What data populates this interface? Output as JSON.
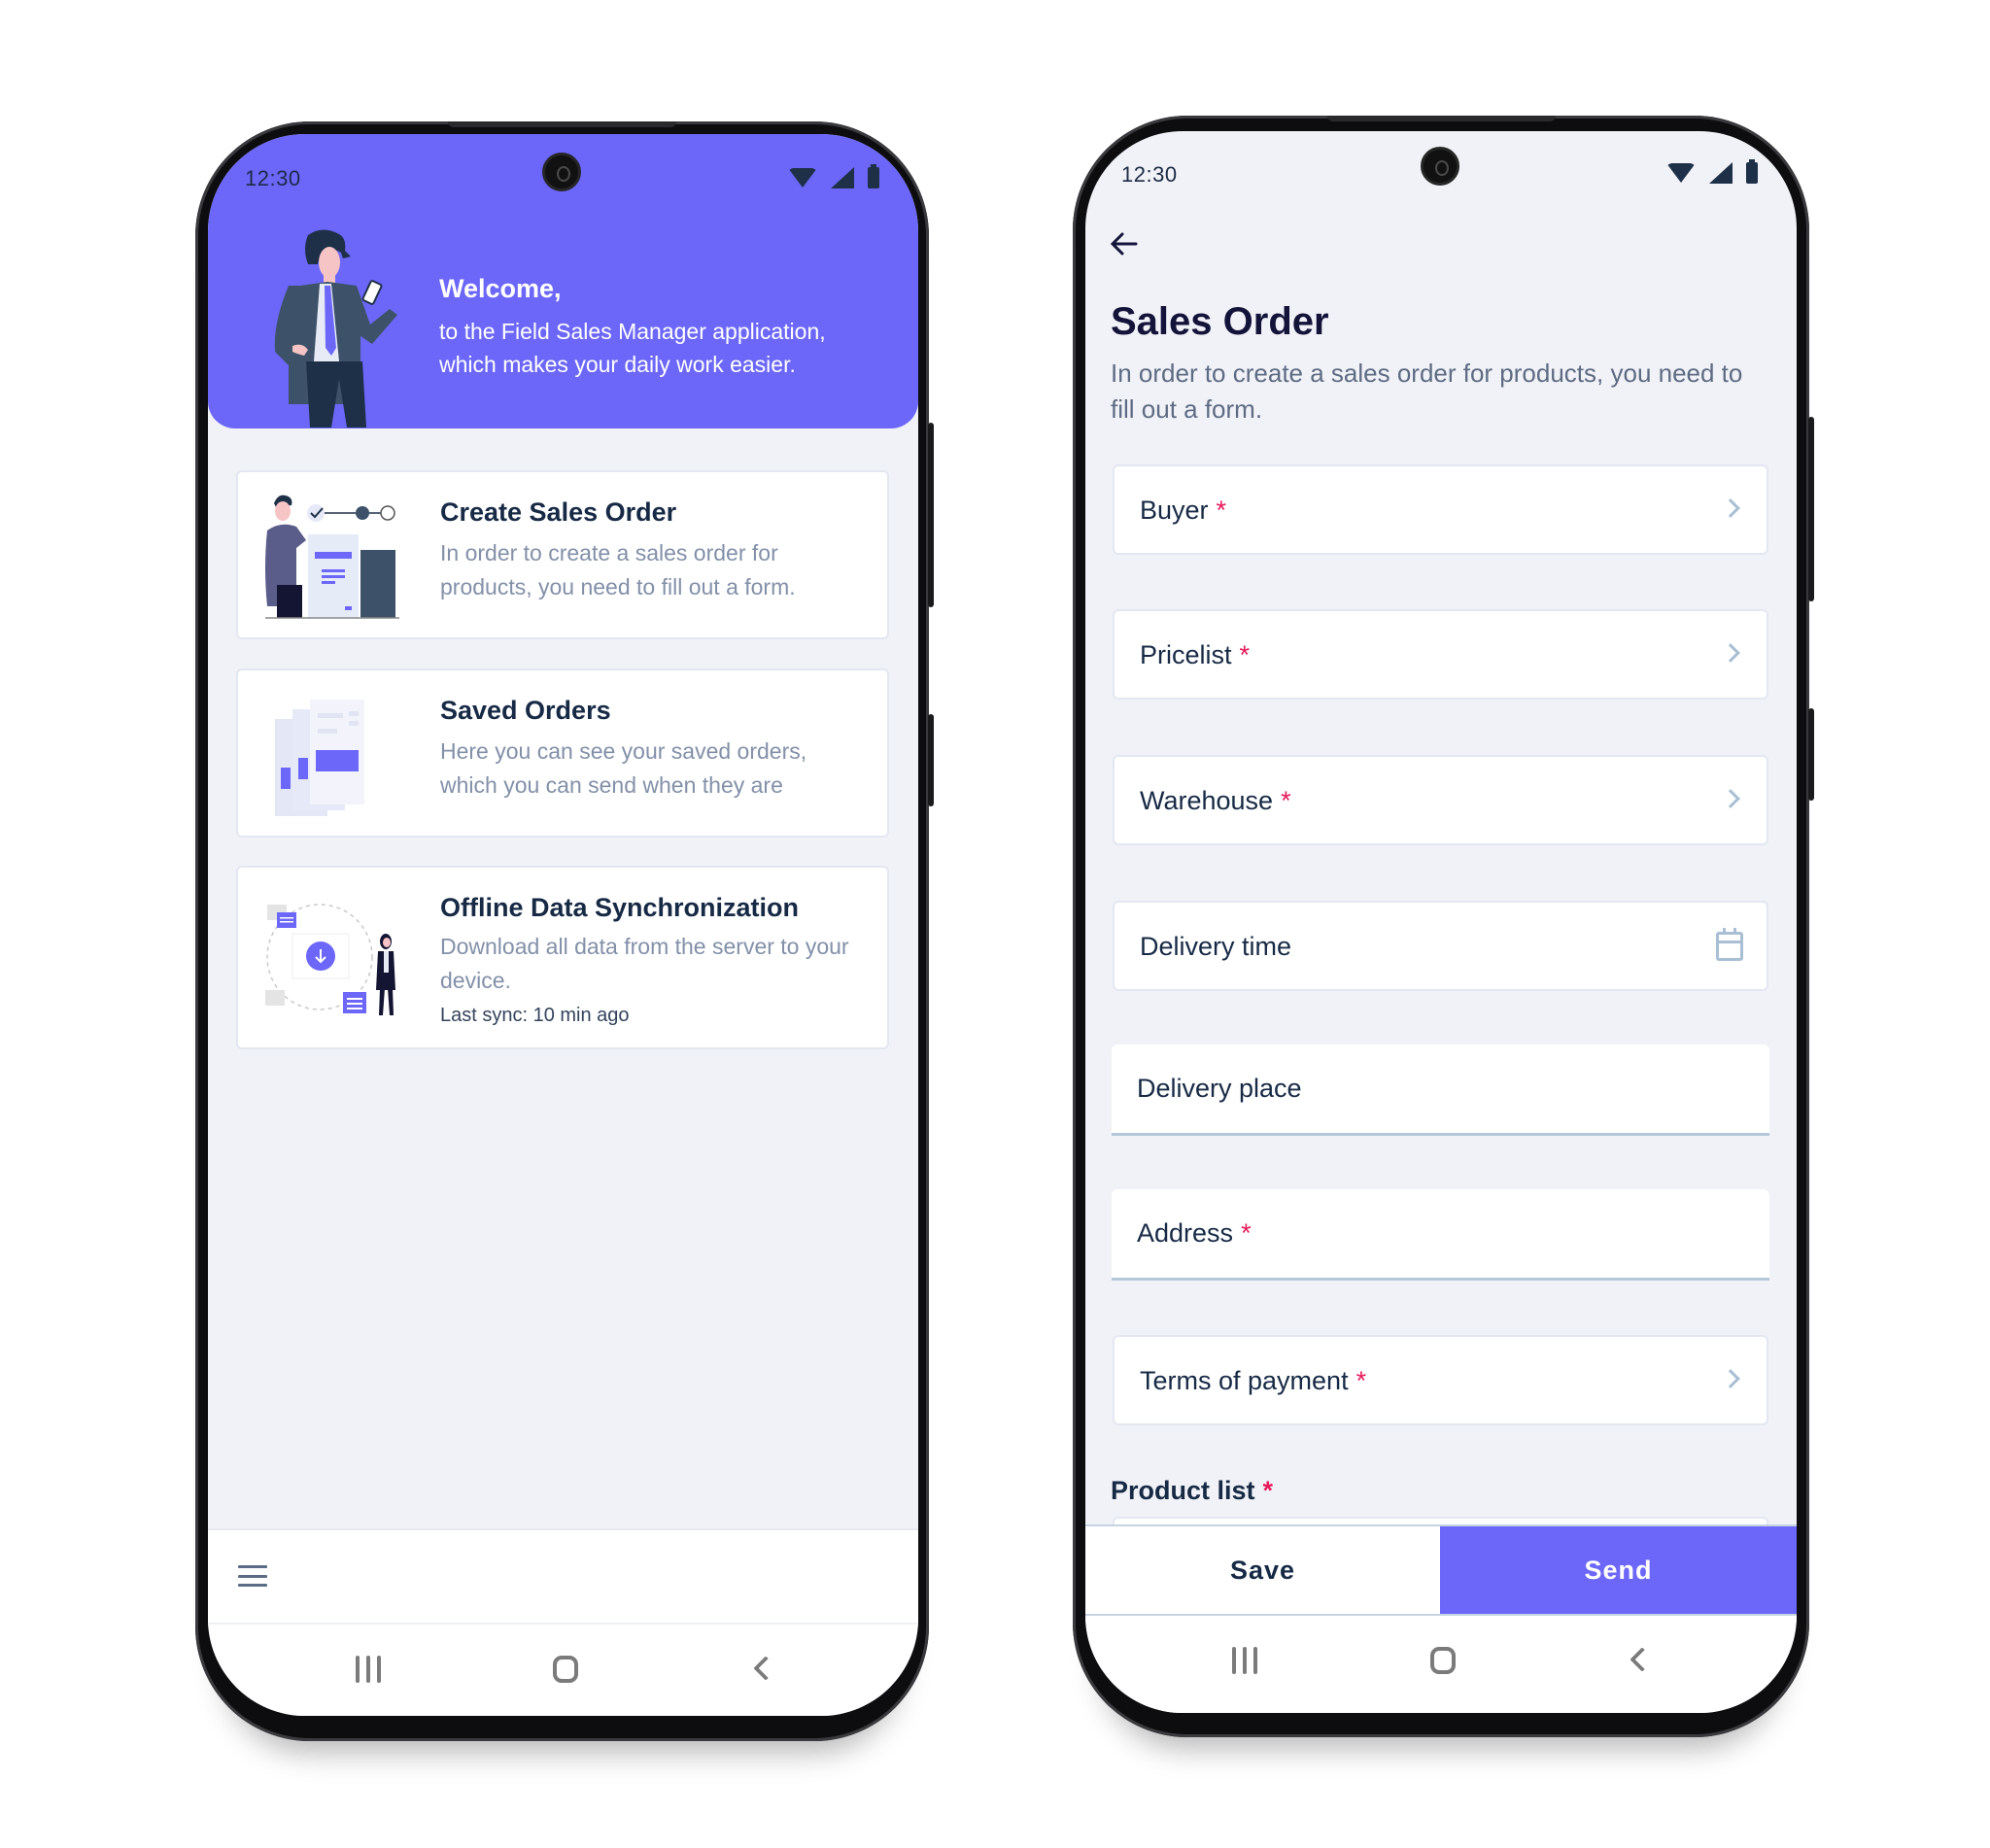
{
  "colors": {
    "accent": "#6c67f9",
    "background": "#f1f2f7",
    "required": "#e6195a",
    "title": "#172a45",
    "muted": "#8290a8"
  },
  "home_screen": {
    "status_bar": {
      "time": "12:30",
      "icons": [
        "wifi-icon",
        "signal-icon",
        "battery-icon"
      ]
    },
    "hero": {
      "title": "Welcome,",
      "line1": "to the Field Sales Manager application,",
      "line2": "which makes your daily work easier.",
      "illustration": "businessman-with-phone"
    },
    "cards": [
      {
        "title": "Create Sales Order",
        "description": "In order to create a sales order for products, you need to fill out a form.",
        "illustration": "person-with-form-steps"
      },
      {
        "title": "Saved Orders",
        "description": "Here you can see your saved orders, which you can send when they are",
        "illustration": "stacked-documents"
      },
      {
        "title": "Offline Data Synchronization",
        "description": "Download all data from the server to your device.",
        "meta": "Last sync: 10 min ago",
        "illustration": "download-sync-with-person"
      }
    ],
    "bottom_bar": {
      "menu_icon": "hamburger-menu-icon"
    },
    "system_nav": [
      "recent-apps",
      "home",
      "back"
    ]
  },
  "sales_order_screen": {
    "status_bar": {
      "time": "12:30",
      "icons": [
        "wifi-icon",
        "signal-icon",
        "battery-icon"
      ]
    },
    "back_icon": "arrow-left-icon",
    "title": "Sales Order",
    "description": "In order to create a sales order for products, you need to fill out a form.",
    "fields": [
      {
        "label": "Buyer",
        "required": true,
        "type": "select",
        "value": ""
      },
      {
        "label": "Pricelist",
        "required": true,
        "type": "select",
        "value": ""
      },
      {
        "label": "Warehouse",
        "required": true,
        "type": "select",
        "value": ""
      },
      {
        "label": "Delivery time",
        "required": false,
        "type": "date",
        "value": ""
      },
      {
        "label": "Delivery place",
        "required": false,
        "type": "text",
        "value": ""
      },
      {
        "label": "Address",
        "required": true,
        "type": "text",
        "value": ""
      },
      {
        "label": "Terms of payment",
        "required": true,
        "type": "select",
        "value": ""
      }
    ],
    "required_marker": "*",
    "product_list_label": "Product list",
    "actions": {
      "save": "Save",
      "send": "Send"
    },
    "system_nav": [
      "recent-apps",
      "home",
      "back"
    ]
  }
}
